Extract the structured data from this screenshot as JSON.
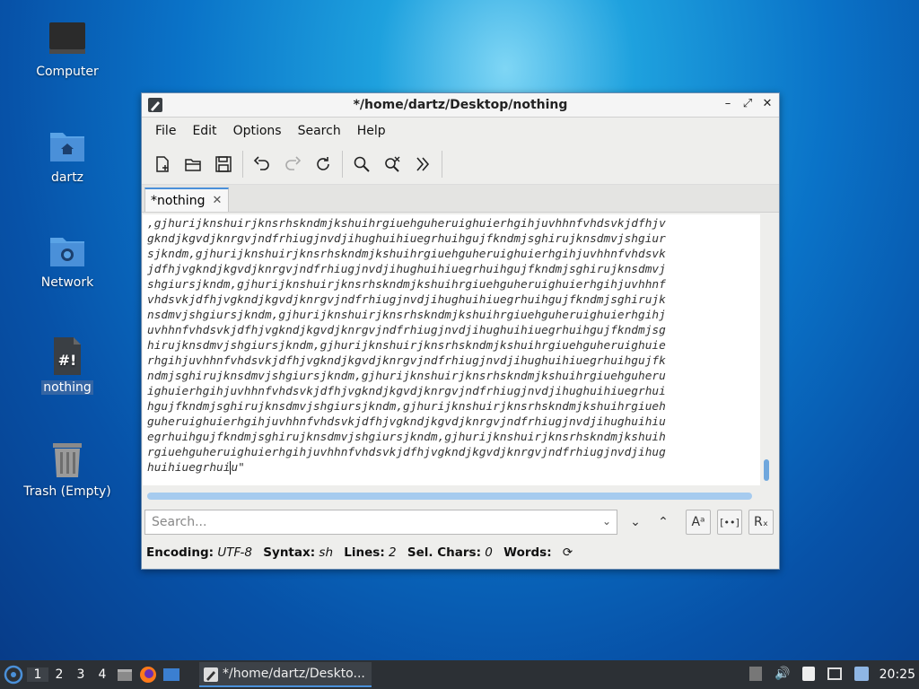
{
  "desktop": {
    "icons": [
      {
        "label": "Computer"
      },
      {
        "label": "dartz"
      },
      {
        "label": "Network"
      },
      {
        "label": "nothing"
      },
      {
        "label": "Trash (Empty)"
      }
    ]
  },
  "window": {
    "title": "*/home/dartz/Desktop/nothing",
    "menu": [
      "File",
      "Edit",
      "Options",
      "Search",
      "Help"
    ],
    "tab_label": "*nothing",
    "editor_lines": [
      ",gjhurijknshuirjknsrhskndmjkshuihrgiuehguheruighuierhgihjuvhhnfvhdsvkjdfhjv",
      "gkndjkgvdjknrgvjndfrhiugjnvdjihughuihiuegrhuihgujfkndmjsghirujknsdmvjshgiur",
      "sjkndm,gjhurijknshuirjknsrhskndmjkshuihrgiuehguheruighuierhgihjuvhhnfvhdsvk",
      "jdfhjvgkndjkgvdjknrgvjndfrhiugjnvdjihughuihiuegrhuihgujfkndmjsghirujknsdmvj",
      "shgiursjkndm,gjhurijknshuirjknsrhskndmjkshuihrgiuehguheruighuierhgihjuvhhnf",
      "vhdsvkjdfhjvgkndjkgvdjknrgvjndfrhiugjnvdjihughuihiuegrhuihgujfkndmjsghirujk",
      "nsdmvjshgiursjkndm,gjhurijknshuirjknsrhskndmjkshuihrgiuehguheruighuierhgihj",
      "uvhhnfvhdsvkjdfhjvgkndjkgvdjknrgvjndfrhiugjnvdjihughuihiuegrhuihgujfkndmjsg",
      "hirujknsdmvjshgiursjkndm,gjhurijknshuirjknsrhskndmjkshuihrgiuehguheruighuie",
      "rhgihjuvhhnfvhdsvkjdfhjvgkndjkgvdjknrgvjndfrhiugjnvdjihughuihiuegrhuihgujfk",
      "ndmjsghirujknsdmvjshgiursjkndm,gjhurijknshuirjknsrhskndmjkshuihrgiuehguheru",
      "ighuierhgihjuvhhnfvhdsvkjdfhjvgkndjkgvdjknrgvjndfrhiugjnvdjihughuihiuegrhui",
      "hgujfkndmjsghirujknsdmvjshgiursjkndm,gjhurijknshuirjknsrhskndmjkshuihrgiueh",
      "guheruighuierhgihjuvhhnfvhdsvkjdfhjvgkndjkgvdjknrgvjndfrhiugjnvdjihughuihiu",
      "egrhuihgujfkndmjsghirujknsdmvjshgiursjkndm,gjhurijknshuirjknsrhskndmjkshuih",
      "rgiuehguheruighuierhgihjuvhhnfvhdsvkjdfhjvgkndjkgvdjknrgvjndfrhiugjnvdjihug"
    ],
    "last_line_before_caret": "huihiuegrhui",
    "last_line_after_caret": "u\"",
    "search_placeholder": "Search...",
    "status": {
      "encoding_label": "Encoding:",
      "encoding_value": "UTF-8",
      "syntax_label": "Syntax:",
      "syntax_value": "sh",
      "lines_label": "Lines:",
      "lines_value": "2",
      "selchars_label": "Sel. Chars:",
      "selchars_value": "0",
      "words_label": "Words:"
    }
  },
  "taskbar": {
    "workspaces": [
      "1",
      "2",
      "3",
      "4"
    ],
    "task_title": "*/home/dartz/Deskto...",
    "clock": "20:25"
  }
}
